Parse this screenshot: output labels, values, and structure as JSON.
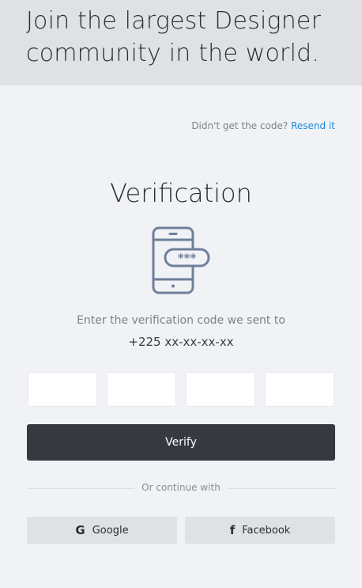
{
  "hero": {
    "title": "Join the largest Designer community in the world."
  },
  "resend": {
    "prompt": "Didn't get the code?",
    "link": "Resend it"
  },
  "verification": {
    "title": "Verification",
    "icon": "phone-password-icon",
    "instruction": "Enter the verification code we sent to",
    "phone_number": "+225 xx-xx-xx-xx"
  },
  "code_inputs": [
    "",
    "",
    "",
    ""
  ],
  "verify_button": {
    "label": "Verify"
  },
  "divider": {
    "text": "Or continue with"
  },
  "social": {
    "google": {
      "label": "Google",
      "icon": "google-icon"
    },
    "facebook": {
      "label": "Facebook",
      "icon": "facebook-icon"
    }
  },
  "colors": {
    "background": "#f0f2f6",
    "hero": "#dfe1e5",
    "accent_link": "#1f8ad6",
    "primary_button": "#363940",
    "icon_stroke": "#6f7f9b"
  }
}
